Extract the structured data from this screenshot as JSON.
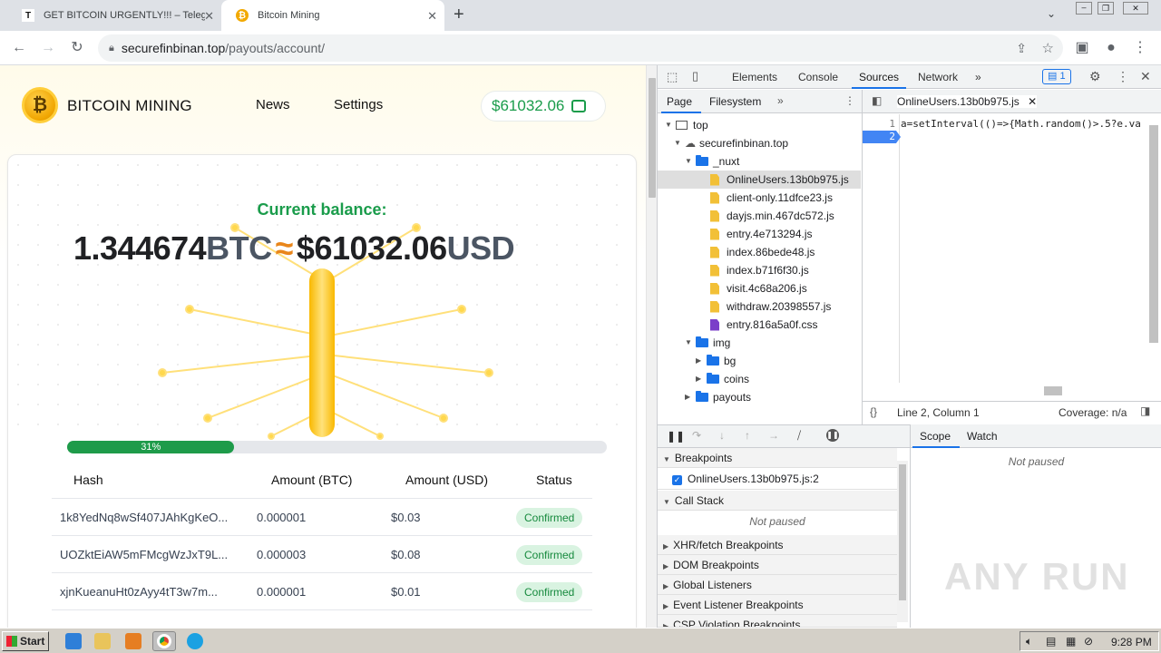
{
  "browser": {
    "tabs": [
      {
        "title": "GET BITCOIN URGENTLY!!! – Telegra",
        "favicon": "T"
      },
      {
        "title": "Bitcoin Mining",
        "favicon": "₿"
      }
    ],
    "url_host": "securefinbinan.top",
    "url_path": "/payouts/account/"
  },
  "site": {
    "brand": "BITCOIN MINING",
    "nav": [
      "News",
      "Settings"
    ],
    "header_balance": "$61032.06",
    "current_balance_label": "Current balance:",
    "btc_amount": "1.344674",
    "btc_unit": "BTC",
    "approx": "≈",
    "usd_amount": "$61032.06",
    "usd_unit": "USD",
    "progress_percent": 31,
    "progress_label": "31%",
    "table_headers": [
      "Hash",
      "Amount (BTC)",
      "Amount (USD)",
      "Status"
    ],
    "rows": [
      {
        "hash": "1k8YedNq8wSf407JAhKgKeO...",
        "btc": "0.000001",
        "usd": "$0.03",
        "status": "Confirmed"
      },
      {
        "hash": "UOZktEiAW5mFMcgWzJxT9L...",
        "btc": "0.000003",
        "usd": "$0.08",
        "status": "Confirmed"
      },
      {
        "hash": "xjnKueanuHt0zAyy4tT3w7m...",
        "btc": "0.000001",
        "usd": "$0.01",
        "status": "Confirmed"
      }
    ]
  },
  "devtools": {
    "tabs": [
      "Elements",
      "Console",
      "Sources",
      "Network"
    ],
    "issues_count": "1",
    "nav_tabs": [
      "Page",
      "Filesystem"
    ],
    "tree": {
      "top": "top",
      "domain": "securefinbinan.top",
      "nuxt": "_nuxt",
      "files": [
        "OnlineUsers.13b0b975.js",
        "client-only.11dfce23.js",
        "dayjs.min.467dc572.js",
        "entry.4e713294.js",
        "index.86bede48.js",
        "index.b71f6f30.js",
        "visit.4c68a206.js",
        "withdraw.20398557.js",
        "entry.816a5a0f.css"
      ],
      "img": "img",
      "img_children": [
        "bg",
        "coins"
      ],
      "payouts": "payouts"
    },
    "open_file": "OnlineUsers.13b0b975.js",
    "line_numbers": [
      "1",
      "2"
    ],
    "code_line1": "a=setInterval(()=>{Math.random()>.5?e.va",
    "status_position": "Line 2, Column 1",
    "coverage": "Coverage: n/a",
    "breakpoints_label": "Breakpoints",
    "breakpoint_item": "OnlineUsers.13b0b975.js:2",
    "call_stack_label": "Call Stack",
    "not_paused": "Not paused",
    "sections": [
      "XHR/fetch Breakpoints",
      "DOM Breakpoints",
      "Global Listeners",
      "Event Listener Breakpoints",
      "CSP Violation Breakpoints"
    ],
    "scope_tabs": [
      "Scope",
      "Watch"
    ],
    "scope_not_paused": "Not paused"
  },
  "taskbar": {
    "start": "Start",
    "clock": "9:28 PM"
  },
  "watermark": "ANY RUN"
}
